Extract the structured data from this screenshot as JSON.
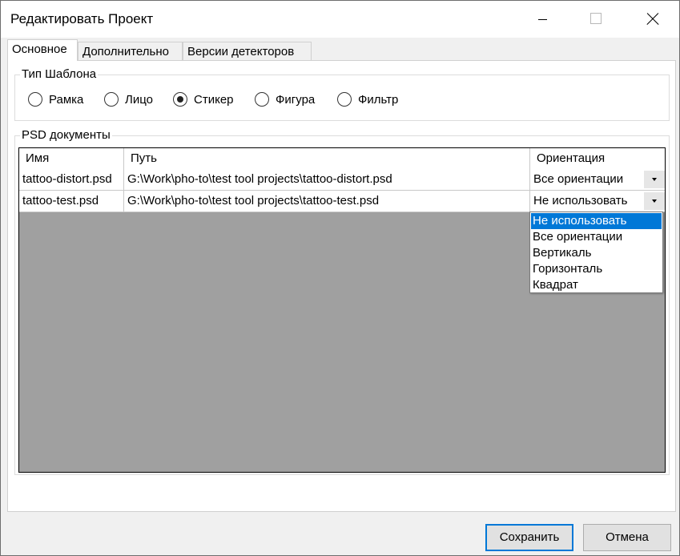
{
  "window": {
    "title": "Редактировать Проект"
  },
  "tabs": [
    {
      "label": "Основное"
    },
    {
      "label": "Дополнительно"
    },
    {
      "label": "Версии детекторов"
    }
  ],
  "template_group": {
    "legend": "Тип Шаблона",
    "options": [
      {
        "label": "Рамка",
        "checked": false
      },
      {
        "label": "Лицо",
        "checked": false
      },
      {
        "label": "Стикер",
        "checked": true
      },
      {
        "label": "Фигура",
        "checked": false
      },
      {
        "label": "Фильтр",
        "checked": false
      }
    ]
  },
  "psd_group": {
    "legend": "PSD документы",
    "columns": [
      "Имя",
      "Путь",
      "Ориентация"
    ],
    "rows": [
      {
        "name": "tattoo-distort.psd",
        "path": "G:\\Work\\pho-to\\test tool projects\\tattoo-distort.psd",
        "orientation": "Все ориентации"
      },
      {
        "name": "tattoo-test.psd",
        "path": "G:\\Work\\pho-to\\test tool projects\\tattoo-test.psd",
        "orientation": "Не использовать"
      }
    ],
    "dropdown_options": [
      "Не использовать",
      "Все ориентации",
      "Вертикаль",
      "Горизонталь",
      "Квадрат"
    ],
    "dropdown_selected": "Не использовать"
  },
  "buttons": {
    "save": "Сохранить",
    "cancel": "Отмена"
  },
  "colors": {
    "selection": "#0078d7",
    "grid_background": "#a0a0a0"
  }
}
